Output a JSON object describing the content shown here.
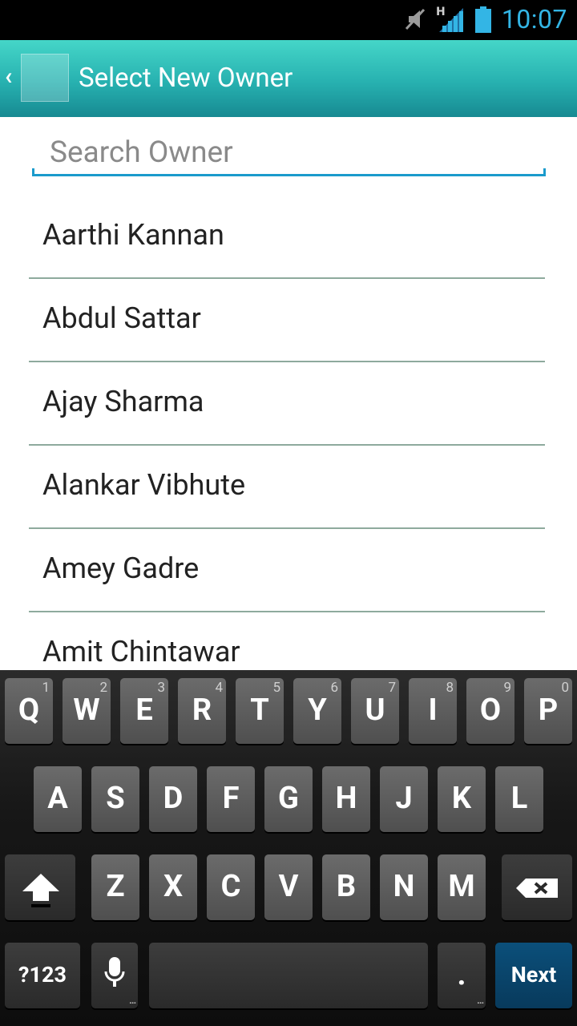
{
  "status_bar": {
    "time": "10:07",
    "network_type": "H"
  },
  "action_bar": {
    "title": "Select New Owner"
  },
  "search": {
    "placeholder": "Search Owner",
    "value": ""
  },
  "owners": [
    "Aarthi Kannan",
    "Abdul Sattar",
    "Ajay Sharma",
    "Alankar Vibhute",
    "Amey Gadre",
    "Amit Chintawar"
  ],
  "keyboard": {
    "row1": [
      {
        "label": "Q",
        "hint": "1"
      },
      {
        "label": "W",
        "hint": "2"
      },
      {
        "label": "E",
        "hint": "3"
      },
      {
        "label": "R",
        "hint": "4"
      },
      {
        "label": "T",
        "hint": "5"
      },
      {
        "label": "Y",
        "hint": "6"
      },
      {
        "label": "U",
        "hint": "7"
      },
      {
        "label": "I",
        "hint": "8"
      },
      {
        "label": "O",
        "hint": "9"
      },
      {
        "label": "P",
        "hint": "0"
      }
    ],
    "row2": [
      "A",
      "S",
      "D",
      "F",
      "G",
      "H",
      "J",
      "K",
      "L"
    ],
    "row3": [
      "Z",
      "X",
      "C",
      "V",
      "B",
      "N",
      "M"
    ],
    "symbols_label": "?123",
    "period_label": ".",
    "next_label": "Next"
  },
  "colors": {
    "accent": "#33b5e5",
    "header_top": "#45d6c8",
    "header_bottom": "#178a92",
    "divider": "#8eaa9d",
    "next_key": "#0b4f7a"
  }
}
